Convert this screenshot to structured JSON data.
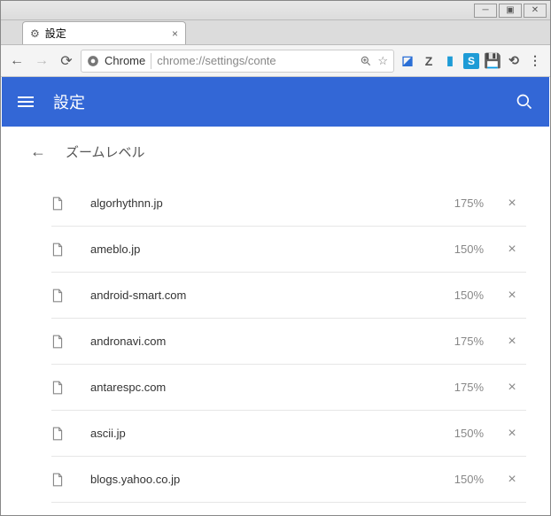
{
  "tab": {
    "title": "設定"
  },
  "omnibox": {
    "label": "Chrome",
    "url": "chrome://settings/conte"
  },
  "appbar": {
    "title": "設定"
  },
  "subhead": {
    "title": "ズームレベル"
  },
  "rows": [
    {
      "host": "algorhythnn.jp",
      "zoom": "175%"
    },
    {
      "host": "ameblo.jp",
      "zoom": "150%"
    },
    {
      "host": "android-smart.com",
      "zoom": "150%"
    },
    {
      "host": "andronavi.com",
      "zoom": "175%"
    },
    {
      "host": "antarespc.com",
      "zoom": "175%"
    },
    {
      "host": "ascii.jp",
      "zoom": "150%"
    },
    {
      "host": "blogs.yahoo.co.jp",
      "zoom": "150%"
    }
  ]
}
